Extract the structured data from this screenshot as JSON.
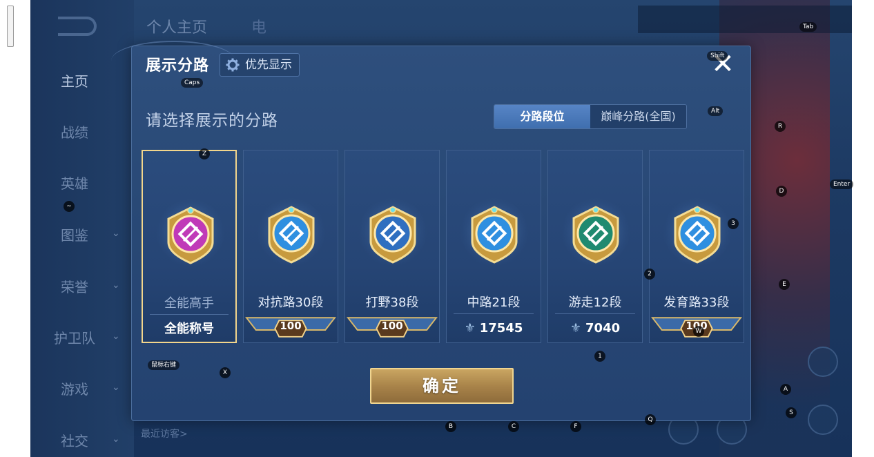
{
  "background": {
    "nav_items": [
      "主页",
      "战绩",
      "英雄",
      "图鉴",
      "荣誉",
      "护卫队",
      "游戏",
      "社交"
    ],
    "tabs": [
      "个人主页",
      "电"
    ],
    "bottom_text": "最近访客>"
  },
  "dialog": {
    "title": "展示分路",
    "priority_button": "优先显示",
    "close_symbol": "✕",
    "subtitle": "请选择展示的分路",
    "segments": [
      "分路段位",
      "巅峰分路(全国)"
    ],
    "active_segment": 0,
    "cards": [
      {
        "name": "全能高手",
        "footer": "全能称号",
        "footer_type": "text",
        "selected": true,
        "medal_color": "#c03ab8"
      },
      {
        "name": "对抗路30段",
        "footer": "100",
        "footer_type": "badge",
        "selected": false,
        "medal_color": "#2f8fe0"
      },
      {
        "name": "打野38段",
        "footer": "100",
        "footer_type": "badge",
        "selected": false,
        "medal_color": "#2f6fc0"
      },
      {
        "name": "中路21段",
        "footer": "17545",
        "footer_type": "score",
        "selected": false,
        "medal_color": "#2f8fe0"
      },
      {
        "name": "游走12段",
        "footer": "7040",
        "footer_type": "score",
        "selected": false,
        "medal_color": "#1f8a70"
      },
      {
        "name": "发育路33段",
        "footer": "100",
        "footer_type": "badge",
        "selected": false,
        "medal_color": "#2f8fe0"
      }
    ],
    "confirm_button": "确定"
  },
  "key_hints": [
    "Tab",
    "Shift",
    "Caps",
    "Alt",
    "R",
    "Z",
    "Enter",
    "D",
    "~",
    "3",
    "2",
    "E",
    "1",
    "鼠标右键",
    "X",
    "A",
    "S",
    "B",
    "C",
    "F",
    "Q",
    "W"
  ]
}
